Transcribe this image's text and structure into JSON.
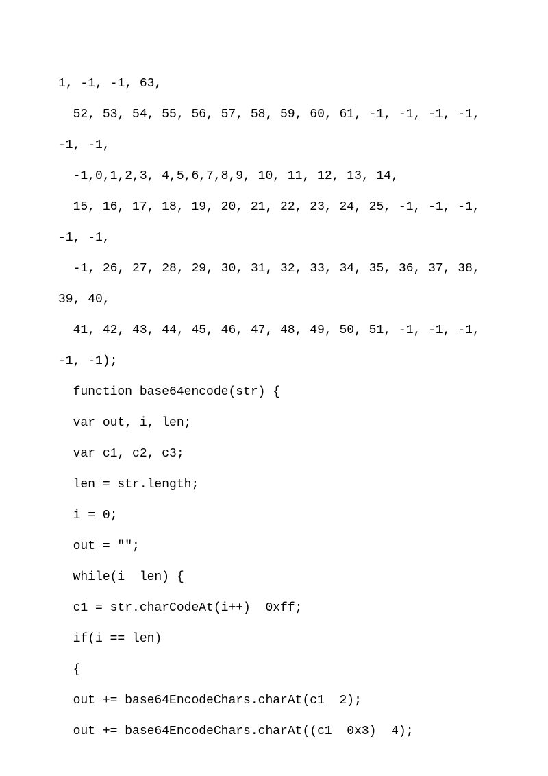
{
  "lines": [
    "1, -1, -1, 63,",
    "  52, 53, 54, 55, 56, 57, 58, 59, 60, 61, -1, -1, -1, -1, -1, -1,",
    "  -1,0,1,2,3, 4,5,6,7,8,9, 10, 11, 12, 13, 14,",
    "  15, 16, 17, 18, 19, 20, 21, 22, 23, 24, 25, -1, -1, -1, -1, -1,",
    "  -1, 26, 27, 28, 29, 30, 31, 32, 33, 34, 35, 36, 37, 38, 39, 40,",
    "  41, 42, 43, 44, 45, 46, 47, 48, 49, 50, 51, -1, -1, -1, -1, -1);",
    "  function base64encode(str) {",
    "  var out, i, len;",
    "  var c1, c2, c3;",
    "  len = str.length;",
    "  i = 0;",
    "  out = \"\";",
    "  while(i  len) {",
    "  c1 = str.charCodeAt(i++)  0xff;",
    "  if(i == len)",
    "  {",
    "  out += base64EncodeChars.charAt(c1  2);",
    "  out += base64EncodeChars.charAt((c1  0x3)  4);"
  ]
}
